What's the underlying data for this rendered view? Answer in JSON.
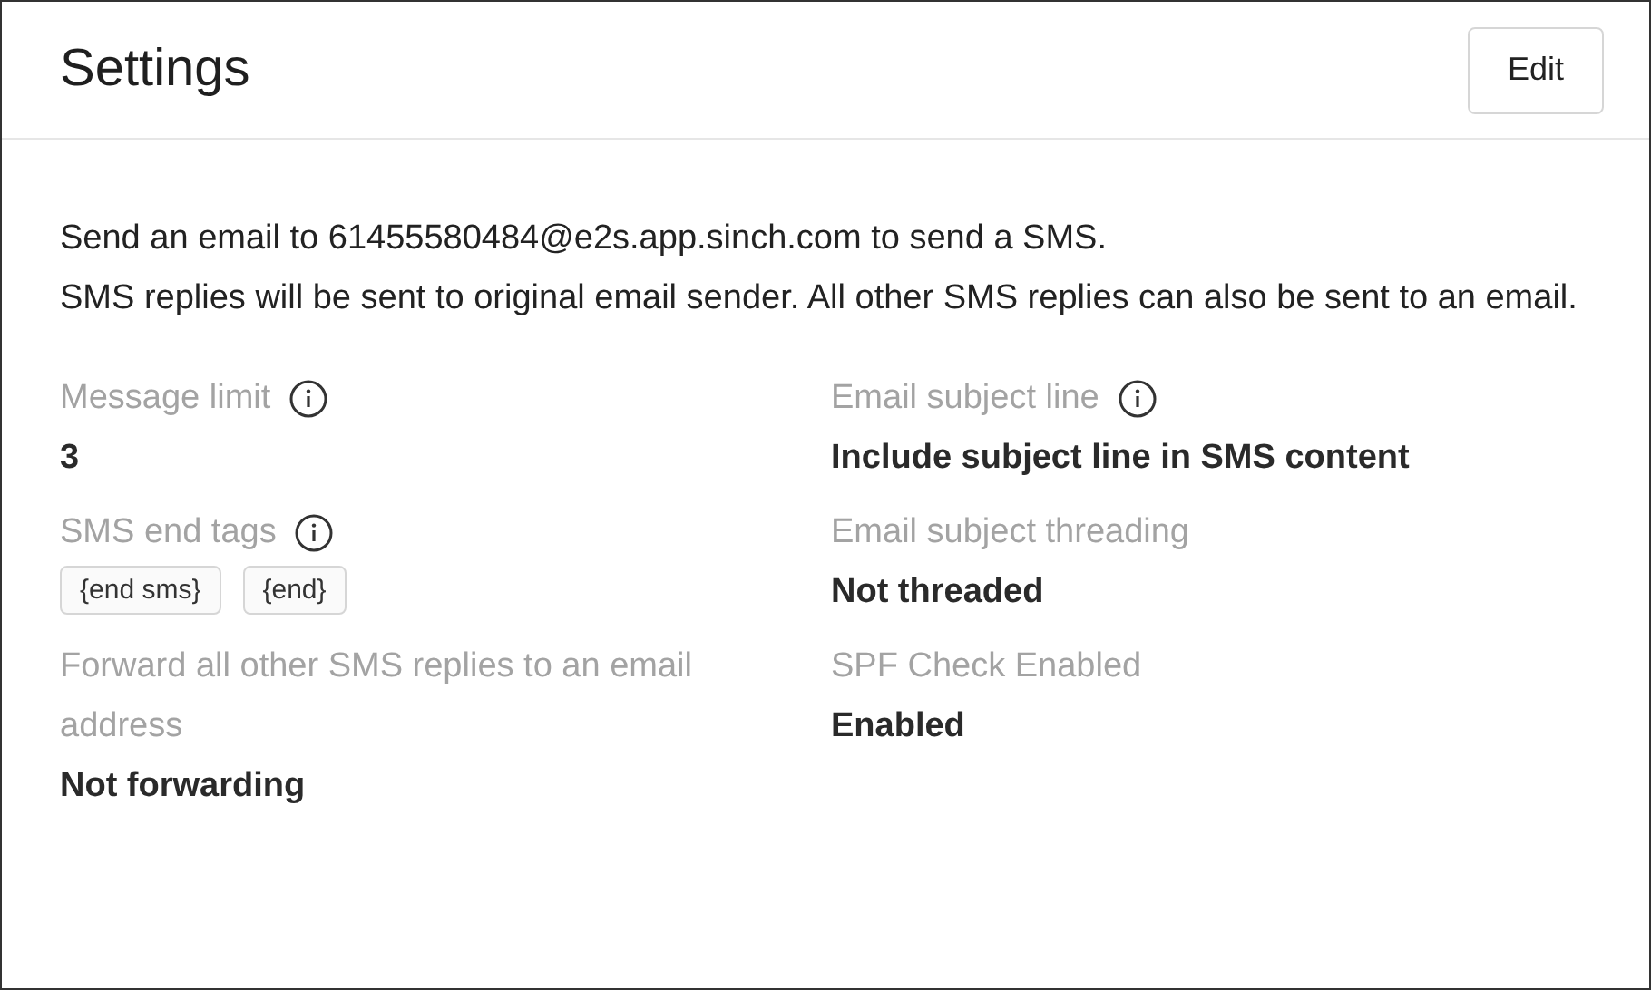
{
  "header": {
    "title": "Settings",
    "edit_button": "Edit"
  },
  "description": [
    "Send an email to 61455580484@e2s.app.sinch.com to send a SMS.",
    "SMS replies will be sent to original email sender. All other SMS replies can also be sent to an email."
  ],
  "fields": [
    {
      "label": "Message limit",
      "info": true,
      "kind": "text",
      "value": "3"
    },
    {
      "label": "Email subject line",
      "info": true,
      "kind": "text",
      "value": "Include subject line in SMS content"
    },
    {
      "label": "SMS end tags",
      "info": true,
      "kind": "tags",
      "tags": [
        "{end sms}",
        "{end}"
      ]
    },
    {
      "label": "Email subject threading",
      "info": false,
      "kind": "text",
      "value": "Not threaded"
    },
    {
      "label": "Forward all other SMS replies to an email address",
      "info": false,
      "kind": "text",
      "value": "Not forwarding"
    },
    {
      "label": "SPF Check Enabled",
      "info": false,
      "kind": "text",
      "value": "Enabled"
    }
  ]
}
